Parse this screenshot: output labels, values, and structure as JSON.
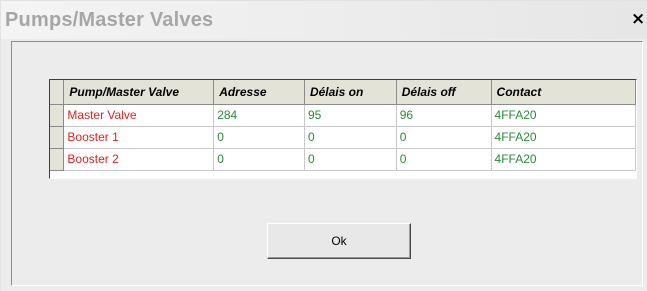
{
  "window": {
    "title": "Pumps/Master Valves",
    "close_label": "×"
  },
  "table": {
    "columns": [
      "Pump/Master Valve",
      "Adresse",
      "Délais on",
      "Délais off",
      "Contact"
    ],
    "rows": [
      [
        "Master Valve",
        "284",
        "95",
        "96",
        "4FFA20"
      ],
      [
        "Booster 1",
        "0",
        "0",
        "0",
        "4FFA20"
      ],
      [
        "Booster 2",
        "0",
        "0",
        "0",
        "4FFA20"
      ]
    ]
  },
  "buttons": {
    "ok_label": "Ok"
  },
  "colors": {
    "name_text": "#e02020",
    "value_text": "#2b8a3c",
    "header_bg": "#e3e3d8",
    "title_text": "#a6a6a6"
  }
}
